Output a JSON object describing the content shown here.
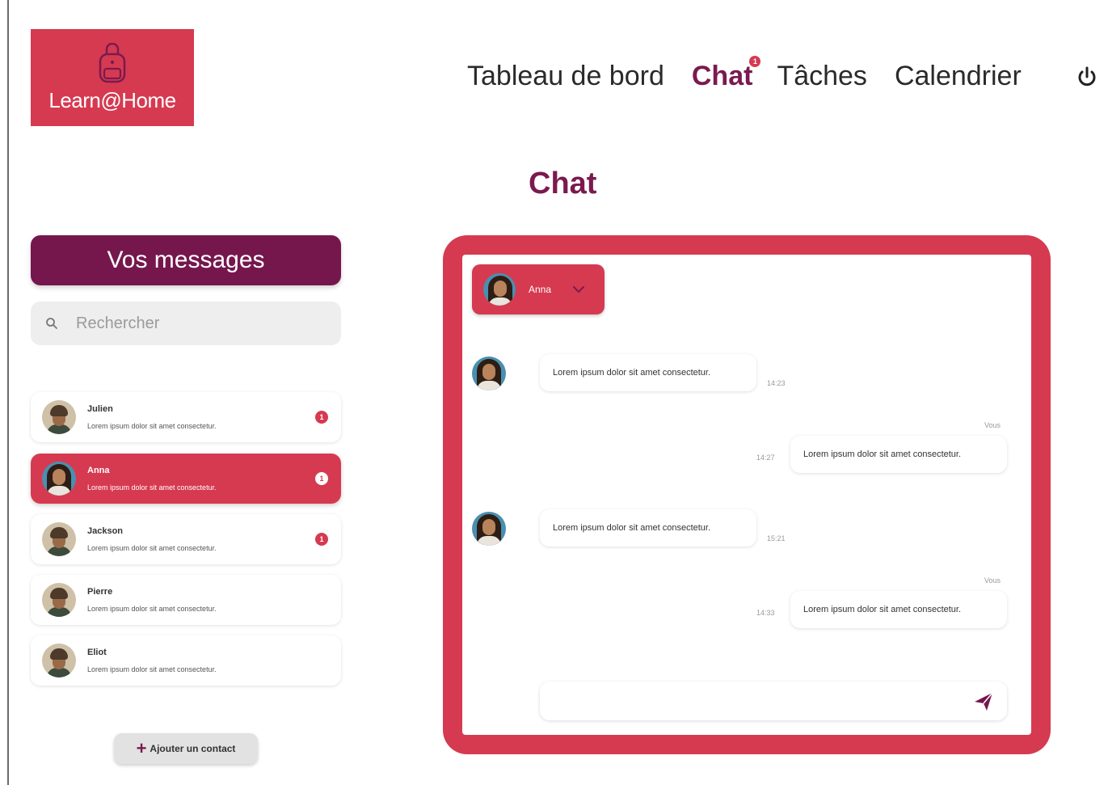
{
  "brand": {
    "name": "Learn@Home",
    "color": "#d63a50",
    "accent": "#75174d"
  },
  "nav": {
    "items": [
      {
        "label": "Tableau de bord",
        "active": false
      },
      {
        "label": "Chat",
        "active": true,
        "badge": "1"
      },
      {
        "label": "Tâches",
        "active": false
      },
      {
        "label": "Calendrier",
        "active": false
      }
    ],
    "power_icon": "power-icon"
  },
  "page": {
    "title": "Chat"
  },
  "sidebar": {
    "header": "Vos messages",
    "search": {
      "placeholder": "Rechercher",
      "value": ""
    },
    "contacts": [
      {
        "name": "Julien",
        "preview": "Lorem ipsum dolor sit amet consectetur.",
        "badge": "1",
        "selected": false
      },
      {
        "name": "Anna",
        "preview": "Lorem ipsum dolor sit amet consectetur.",
        "badge": "1",
        "selected": true
      },
      {
        "name": "Jackson",
        "preview": "Lorem ipsum dolor sit amet consectetur.",
        "badge": "1",
        "selected": false
      },
      {
        "name": "Pierre",
        "preview": "Lorem ipsum dolor sit amet consectetur.",
        "badge": "",
        "selected": false
      },
      {
        "name": "Eliot",
        "preview": "Lorem ipsum dolor sit amet consectetur.",
        "badge": "",
        "selected": false
      }
    ],
    "add_contact_label": "Ajouter un contact"
  },
  "chat": {
    "contact_name": "Anna",
    "messages": [
      {
        "from": "Anna",
        "text": "Lorem ipsum dolor sit amet consectetur.",
        "time": "14:23",
        "sender_label": ""
      },
      {
        "from": "Vous",
        "text": "Lorem ipsum dolor sit amet consectetur.",
        "time": "14:27",
        "sender_label": "Vous"
      },
      {
        "from": "Anna",
        "text": "Lorem ipsum dolor sit amet consectetur.",
        "time": "15:21",
        "sender_label": ""
      },
      {
        "from": "Vous",
        "text": "Lorem ipsum dolor sit amet consectetur.",
        "time": "14:33",
        "sender_label": "Vous"
      }
    ],
    "composer": {
      "placeholder": "",
      "value": ""
    }
  }
}
